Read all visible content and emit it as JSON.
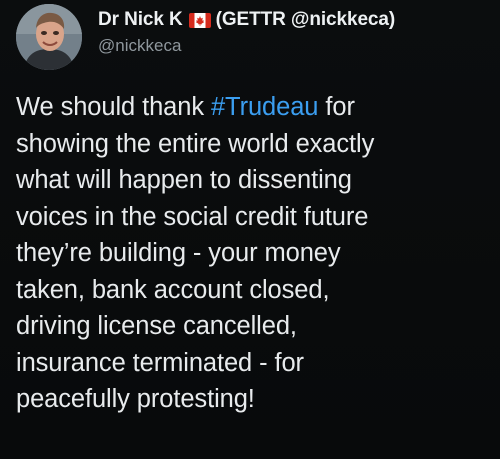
{
  "tweet": {
    "display_name": "Dr Nick K",
    "name_suffix": "(GETTR @nickkeca)",
    "handle": "@nickkeca",
    "flag_icon": "canada-flag-icon",
    "hashtag_color": "#3b9ef0",
    "body": {
      "line1_pre": "We should thank ",
      "line1_hashtag": "#Trudeau",
      "line1_post": " for",
      "line2": "showing the entire world exactly",
      "line3": "what will happen to dissenting",
      "line4": "voices in the social credit future",
      "line5": "they’re building - your money",
      "line6": "taken, bank account closed,",
      "line7": "driving license cancelled,",
      "line8": "insurance terminated - for",
      "line9": "peacefully protesting!"
    }
  }
}
